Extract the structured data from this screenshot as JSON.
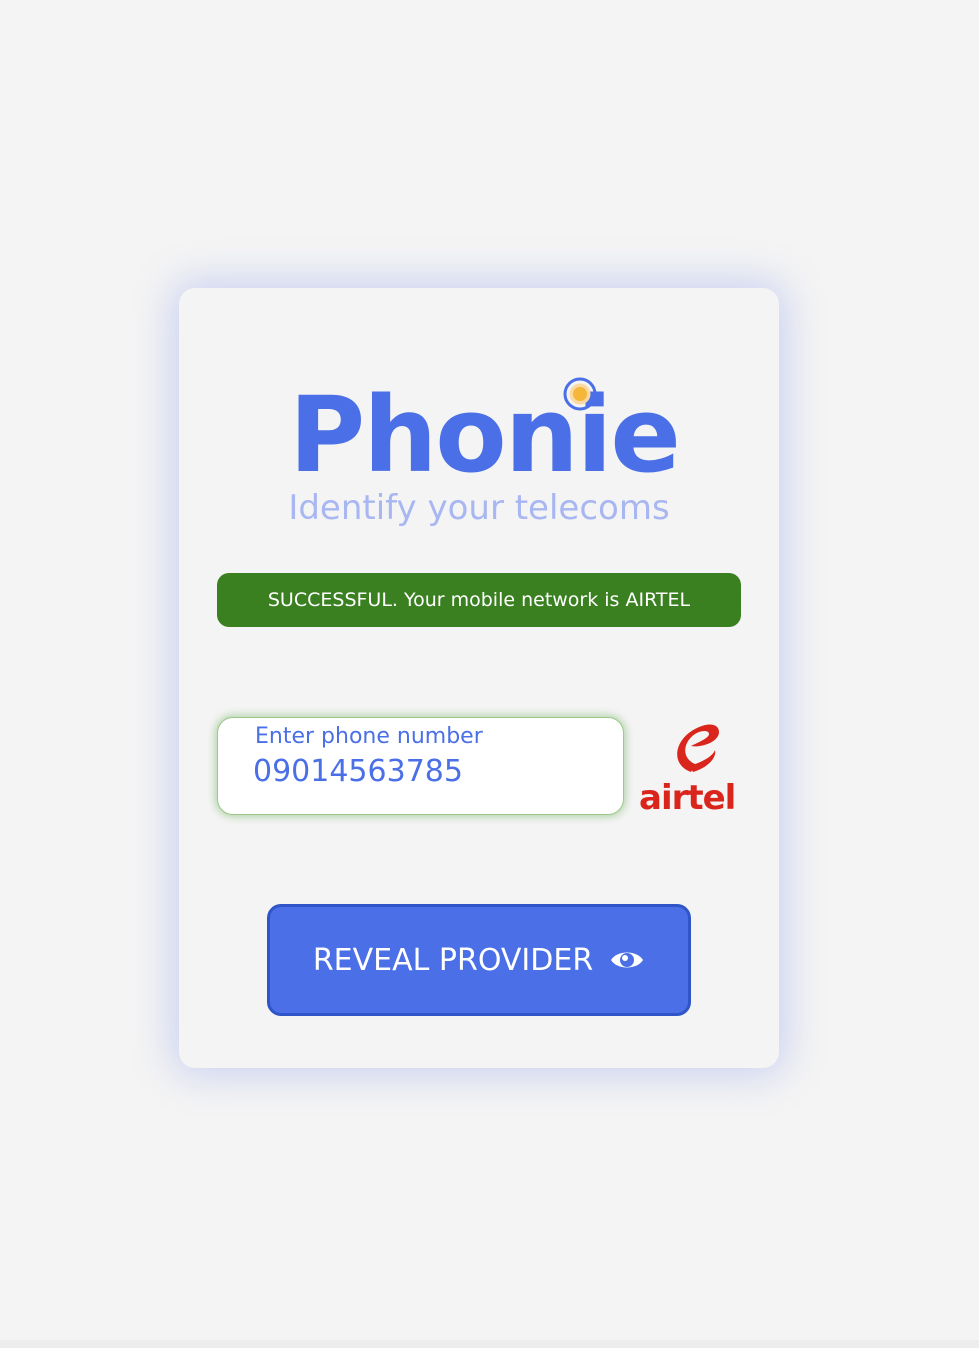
{
  "brand": {
    "name": "Phonie",
    "tagline": "Identify your telecoms"
  },
  "status": {
    "message": "SUCCESSFUL. Your mobile network is AIRTEL",
    "color": "#3a8021"
  },
  "phone_input": {
    "label": "Enter phone number",
    "value": "09014563785"
  },
  "provider": {
    "name": "airtel",
    "logo_icon": "airtel-logo",
    "color": "#d9251c"
  },
  "reveal_button": {
    "label": "REVEAL PROVIDER",
    "icon": "eye-icon"
  },
  "colors": {
    "accent": "#4a6fe6",
    "tagline": "#a8b6f2",
    "background": "#f4f4f4"
  }
}
